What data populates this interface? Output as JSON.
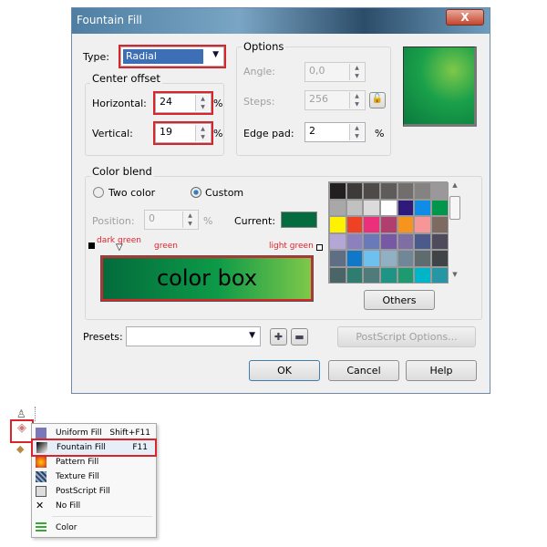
{
  "dialog": {
    "title": "Fountain Fill",
    "close": "X",
    "type_label": "Type:",
    "type_value": "Radial",
    "center_offset": {
      "title": "Center offset",
      "horizontal_label": "Horizontal:",
      "horizontal_value": "24",
      "vertical_label": "Vertical:",
      "vertical_value": "19",
      "unit": "%"
    },
    "options": {
      "title": "Options",
      "angle_label": "Angle:",
      "angle_value": "0,0",
      "steps_label": "Steps:",
      "steps_value": "256",
      "edge_pad_label": "Edge pad:",
      "edge_pad_value": "2",
      "unit": "%"
    },
    "color_blend": {
      "title": "Color blend",
      "two_color": "Two color",
      "custom": "Custom",
      "selected": "custom",
      "position_label": "Position:",
      "position_value": "0",
      "unit": "%",
      "current_label": "Current:",
      "current_color": "#046c3e",
      "annotations": {
        "dark_green": "dark green",
        "green": "green",
        "light_green": "light green",
        "color_box": "color box"
      },
      "gradient": [
        "#036b3c",
        "#0d9a48",
        "#7ec84a"
      ],
      "palette": [
        [
          "#231f20",
          "#3d3a39",
          "#4d4a49",
          "#5e5b5a",
          "#716e6d",
          "#858282",
          "#9a9898"
        ],
        [
          "#a9a8a8",
          "#c2c1c1",
          "#dcdbdb",
          "#ffffff",
          "#2e1a7a",
          "#0f8ce6",
          "#00964b"
        ],
        [
          "#fff200",
          "#ef4123",
          "#ec2f7a",
          "#b03e6e",
          "#f7941d",
          "#f69696",
          "#7d6b61"
        ],
        [
          "#b5a7d5",
          "#8c80bf",
          "#6a7ab8",
          "#7758a5",
          "#7e6ea1",
          "#4a5a8a",
          "#4f4b5c"
        ],
        [
          "#5d6e85",
          "#0f78c8",
          "#6ec0ee",
          "#90b0c3",
          "#6f8796",
          "#5e6b6f",
          "#3f4447"
        ],
        [
          "#4a6468",
          "#2e7d70",
          "#4f7c7a",
          "#1f9484",
          "#1d9a6f",
          "#00b5c8",
          "#2796a4"
        ]
      ],
      "others": "Others"
    },
    "presets_label": "Presets:",
    "presets_value": "",
    "postscript_options": "PostScript Options...",
    "ok": "OK",
    "cancel": "Cancel",
    "help": "Help"
  },
  "fill_menu": {
    "items": [
      {
        "label": "Uniform Fill",
        "shortcut": "Shift+F11",
        "icon": "uniform-fill-icon"
      },
      {
        "label": "Fountain Fill",
        "shortcut": "F11",
        "icon": "fountain-fill-icon",
        "highlighted": true
      },
      {
        "label": "Pattern Fill",
        "shortcut": "",
        "icon": "pattern-fill-icon"
      },
      {
        "label": "Texture Fill",
        "shortcut": "",
        "icon": "texture-fill-icon"
      },
      {
        "label": "PostScript Fill",
        "shortcut": "",
        "icon": "postscript-fill-icon"
      },
      {
        "label": "No Fill",
        "shortcut": "",
        "icon": "no-fill-icon"
      },
      {
        "label": "Color",
        "shortcut": "",
        "icon": "color-icon"
      }
    ]
  }
}
